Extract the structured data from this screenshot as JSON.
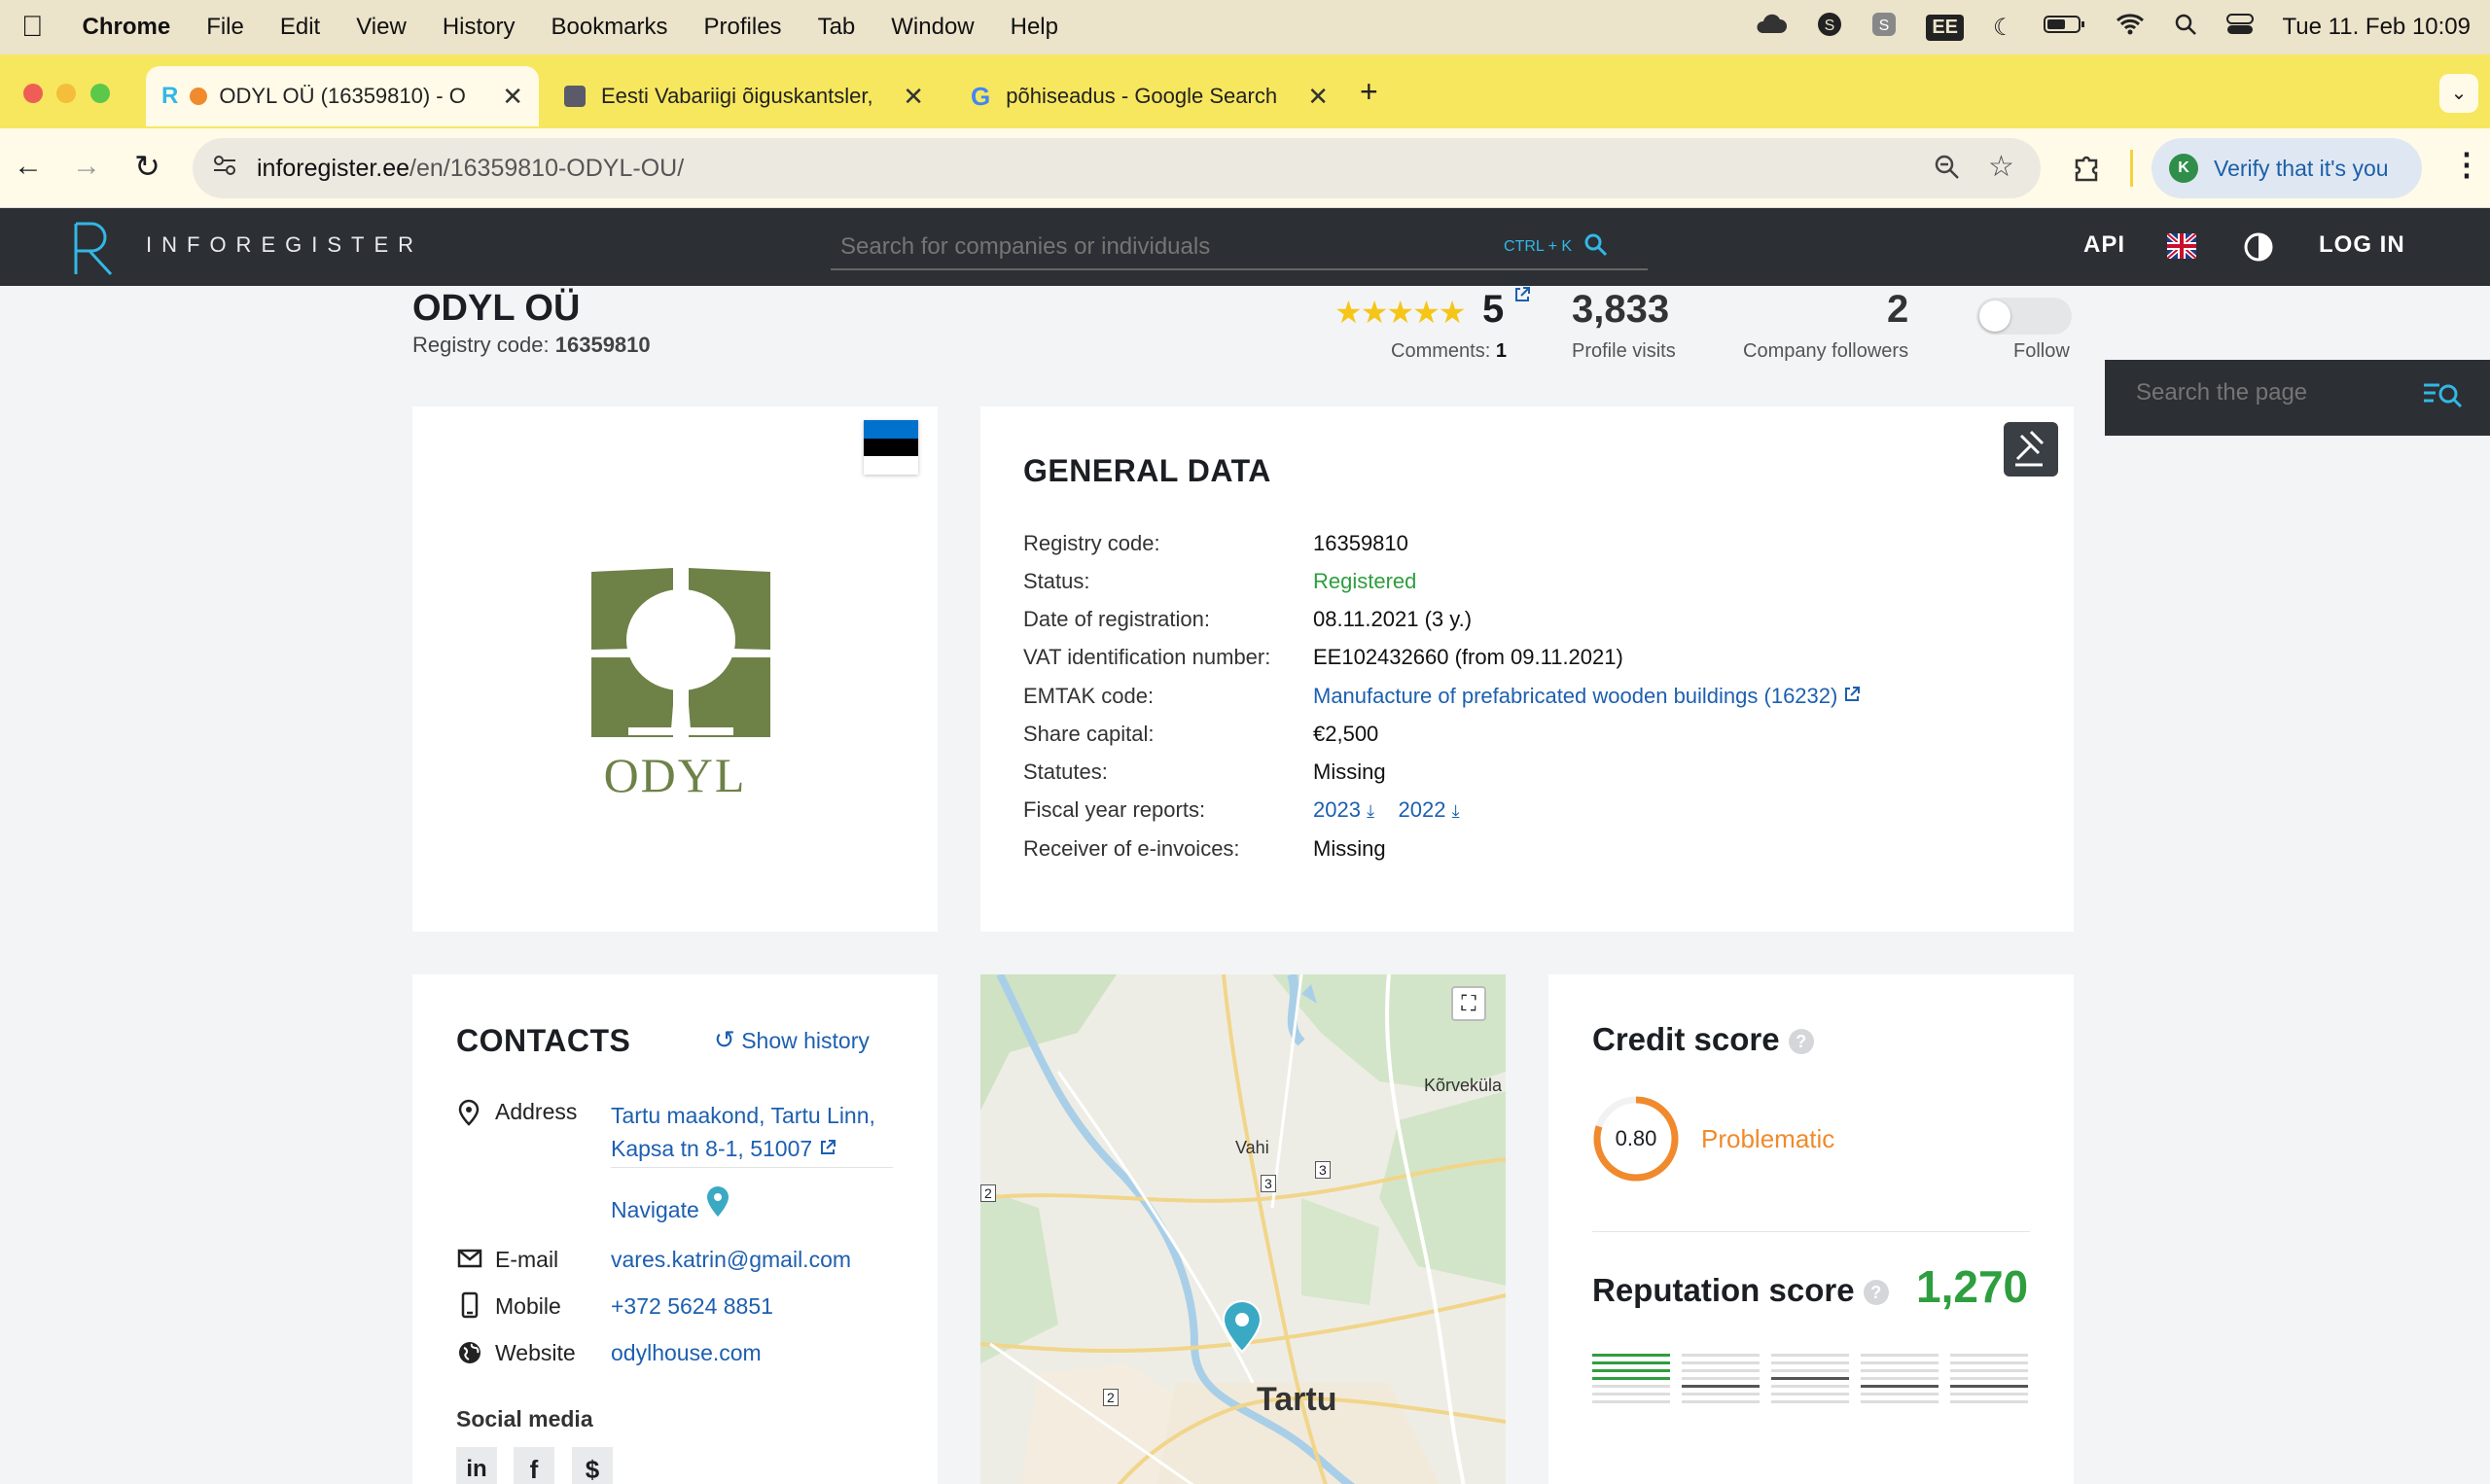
{
  "menubar": {
    "app": "Chrome",
    "items": [
      "File",
      "Edit",
      "View",
      "History",
      "Bookmarks",
      "Profiles",
      "Tab",
      "Window",
      "Help"
    ],
    "datetime": "Tue 11. Feb  10:09",
    "input_source": "EE"
  },
  "tabs": [
    {
      "title": "ODYL OÜ (16359810) - O",
      "active": true
    },
    {
      "title": "Eesti Vabariigi õiguskantsler,",
      "active": false
    },
    {
      "title": "põhiseadus - Google Search",
      "active": false
    }
  ],
  "address": {
    "host": "inforegister.ee",
    "path": "/en/16359810-ODYL-OU/",
    "verify_label": "Verify that it's you"
  },
  "site": {
    "logo_text": "INFOREGISTER",
    "search_placeholder": "Search for companies or individuals",
    "search_kbd": "CTRL + K",
    "api_label": "API",
    "login_label": "LOG IN"
  },
  "company": {
    "name": "ODYL OÜ",
    "registry_label": "Registry code:",
    "registry_code": "16359810",
    "rating": "5",
    "comments_label": "Comments:",
    "comments": "1",
    "profile_visits": "3,833",
    "profile_visits_label": "Profile visits",
    "followers": "2",
    "followers_label": "Company followers",
    "follow_label": "Follow",
    "logo_word": "ODYL"
  },
  "search_page": {
    "placeholder": "Search the page"
  },
  "general": {
    "title": "GENERAL DATA",
    "rows": [
      {
        "label": "Registry code:",
        "value": "16359810"
      },
      {
        "label": "Status:",
        "value": "Registered"
      },
      {
        "label": "Date of registration:",
        "value": "08.11.2021 (3 y.)"
      },
      {
        "label": "VAT identification number:",
        "value": "EE102432660 (from 09.11.2021)"
      },
      {
        "label": "EMTAK code:",
        "value": "Manufacture of prefabricated wooden buildings (16232)"
      },
      {
        "label": "Share capital:",
        "value": "€2,500"
      },
      {
        "label": "Statutes:",
        "value": "Missing"
      },
      {
        "label": "Fiscal year reports:",
        "value": ""
      },
      {
        "label": "Receiver of e-invoices:",
        "value": "Missing"
      }
    ],
    "reports": [
      "2023",
      "2022"
    ]
  },
  "contacts": {
    "title": "CONTACTS",
    "history_label": "Show history",
    "address_label": "Address",
    "address_line1": "Tartu maakond, Tartu Linn,",
    "address_line2": "Kapsa tn 8-1, 51007",
    "navigate_label": "Navigate",
    "email_label": "E-mail",
    "email": "vares.katrin@gmail.com",
    "mobile_label": "Mobile",
    "mobile": "+372 5624 8851",
    "website_label": "Website",
    "website": "odylhouse.com",
    "social_title": "Social media"
  },
  "map": {
    "labels": [
      "Kõrveküla",
      "Vahi",
      "Tartu"
    ],
    "road_numbers": [
      "2",
      "3",
      "3",
      "2"
    ]
  },
  "credit": {
    "title": "Credit score",
    "score": "0.80",
    "score_fraction": 0.8,
    "rating": "Problematic",
    "reputation_title": "Reputation score",
    "reputation_value": "1,270"
  },
  "colors": {
    "accent": "#33b7e6",
    "header_bg": "#2c2f33",
    "link": "#1d5fb0",
    "green": "#2e9e3e",
    "orange": "#f08a2c",
    "logo_green": "#6e8248"
  }
}
